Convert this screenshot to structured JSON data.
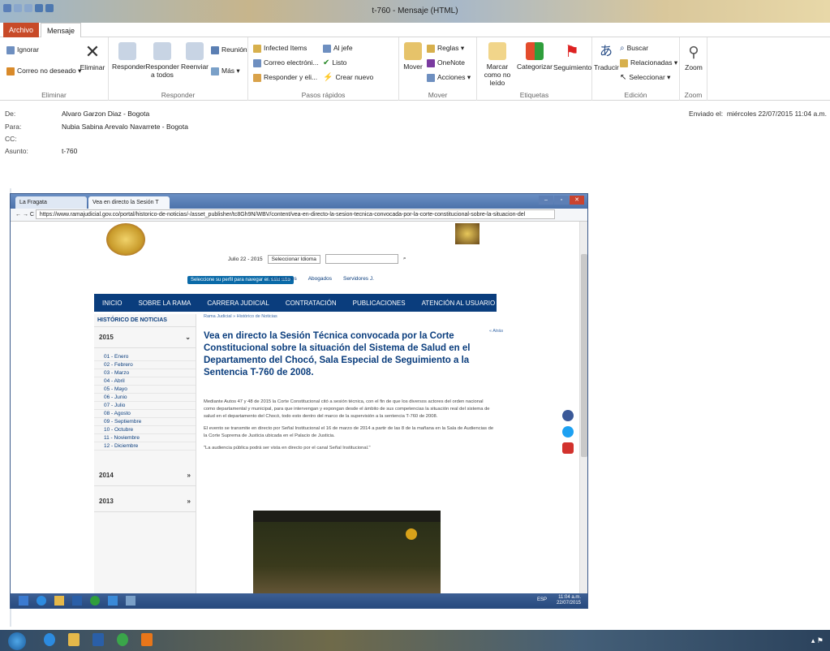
{
  "window": {
    "title": "t-760 - Mensaje (HTML)"
  },
  "tabs": {
    "file": "Archivo",
    "message": "Mensaje"
  },
  "ribbon": {
    "eliminar": {
      "ignore": "Ignorar",
      "junk": "Correo no deseado ▾",
      "delete": "Eliminar",
      "label": "Eliminar"
    },
    "responder": {
      "reply": "Responder",
      "reply_all": "Responder a todos",
      "forward": "Reenviar",
      "meeting": "Reunión",
      "more": "Más ▾",
      "label": "Responder"
    },
    "pasos": {
      "items": [
        "Infected Items",
        "Correo electróni...",
        "Responder y eli...",
        "Al jefe",
        "Listo",
        "Crear nuevo"
      ],
      "label": "Pasos rápidos"
    },
    "mover": {
      "move": "Mover",
      "rules": "Reglas ▾",
      "onenote": "OneNote",
      "actions": "Acciones ▾",
      "label": "Mover"
    },
    "etiquetas": {
      "unread": "Marcar como no leído",
      "categorize": "Categorizar",
      "followup": "Seguimiento",
      "label": "Etiquetas"
    },
    "edicion": {
      "translate": "Traducir",
      "find": "Buscar",
      "related": "Relacionadas ▾",
      "select": "Seleccionar ▾",
      "label": "Edición"
    },
    "zoom": {
      "zoom": "Zoom",
      "label": "Zoom"
    }
  },
  "header": {
    "from_label": "De:",
    "from": "Alvaro Garzon Diaz - Bogota",
    "to_label": "Para:",
    "to": "Nubia Sabina Arevalo Navarrete - Bogota",
    "cc_label": "CC:",
    "subject_label": "Asunto:",
    "subject": "t-760",
    "sent_label": "Enviado el:",
    "sent": "miércoles 22/07/2015 11:04 a.m."
  },
  "browser": {
    "tab1": "La Fragata",
    "tab2": "Vea en directo la Sesión T",
    "url": "https://www.ramajudicial.gov.co/portal/historico-de-noticias/-/asset_publisher/tc8Gh9N/WBV/content/vea-en-directo-la-sesion-tecnica-convocada-por-la-corte-constitucional-sobre-la-situacion-del"
  },
  "site": {
    "date": "Julio 22 - 2015",
    "lang": "Seleccionar Idioma",
    "profile": "Seleccione su perfil para navegar en este sitio",
    "roles": [
      "Ciudadanos",
      "Abogados",
      "Servidores J."
    ],
    "nav": [
      "INICIO",
      "SOBRE LA RAMA",
      "CARRERA JUDICIAL",
      "CONTRATACIÓN",
      "PUBLICACIONES",
      "ATENCIÓN AL USUARIO"
    ],
    "sidebar_head": "HISTÓRICO DE NOTICIAS",
    "years": [
      "2015",
      "2014",
      "2013"
    ],
    "months": [
      "01 - Enero",
      "02 - Febrero",
      "03 - Marzo",
      "04 - Abril",
      "05 - Mayo",
      "06 - Junio",
      "07 - Julio",
      "08 - Agosto",
      "09 - Septiembre",
      "10 - Octubre",
      "11 - Noviembre",
      "12 - Diciembre"
    ],
    "crumb": "Rama Judicial » Histórico de Noticias",
    "title": "Vea en directo la Sesión Técnica convocada por la Corte Constitucional sobre la situación del Sistema de Salud en el Departamento del Chocó, Sala Especial de Seguimiento a la Sentencia T-760 de 2008.",
    "back": "« Atrás",
    "p1": "Mediante Autos 47 y 48 de 2015 la Corte Constitucional citó a sesión técnica, con el fin de que los diversos actores del orden nacional como departamental y municipal, para que intervengan y expongan desde el ámbito de sus competencias la situación real del sistema de salud en el departamento del Chocó, todo esto dentro del marco de la supervisión a la sentencia T-760 de 2008.",
    "p2": "El evento se transmite en directo por Señal Institucional el 16 de marzo de 2014 a partir de las 8 de la mañana en la Sala de Audiencias de la Corte Suprema de Justicia ubicada en el Palacio de Justicia.",
    "p3": "\"La audiencia pública podrá ser vista en directo por el canal Señal Institucional.\""
  },
  "inner_taskbar": {
    "time": "11:04 a.m.",
    "date": "22/07/2015",
    "lang": "ESP"
  }
}
